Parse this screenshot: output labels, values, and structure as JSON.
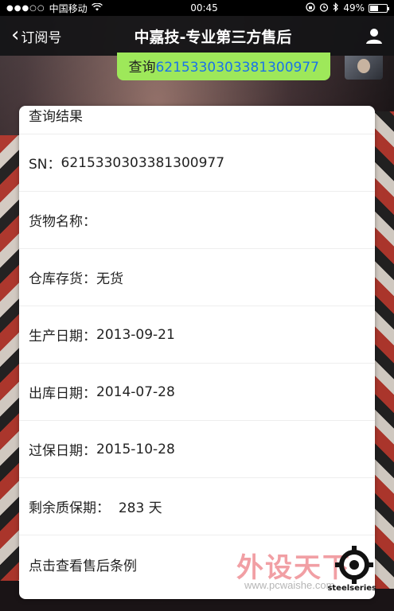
{
  "status_bar": {
    "carrier": "中国移动",
    "time": "00:45",
    "battery": "49%",
    "battery_level": 0.49
  },
  "nav": {
    "back_label": "订阅号",
    "title": "中嘉技-专业第三方售后"
  },
  "message": {
    "prefix": "查询",
    "number": "6215330303381300977"
  },
  "card": {
    "title": "查询结果",
    "rows": [
      {
        "label": "SN：",
        "value": "6215330303381300977"
      },
      {
        "label": "货物名称：",
        "value": ""
      },
      {
        "label": "仓库存货：",
        "value": "无货"
      },
      {
        "label": "生产日期：",
        "value": "2013-09-21"
      },
      {
        "label": "出库日期：",
        "value": "2014-07-28"
      },
      {
        "label": "过保日期：",
        "value": "2015-10-28"
      },
      {
        "label": "剩余质保期：  ",
        "value": "283 天"
      }
    ],
    "link_label": "点击查看售后条例"
  },
  "watermark": {
    "text": "外设天下",
    "url": "www.pcwaishe.com",
    "brand": "steelseries"
  }
}
